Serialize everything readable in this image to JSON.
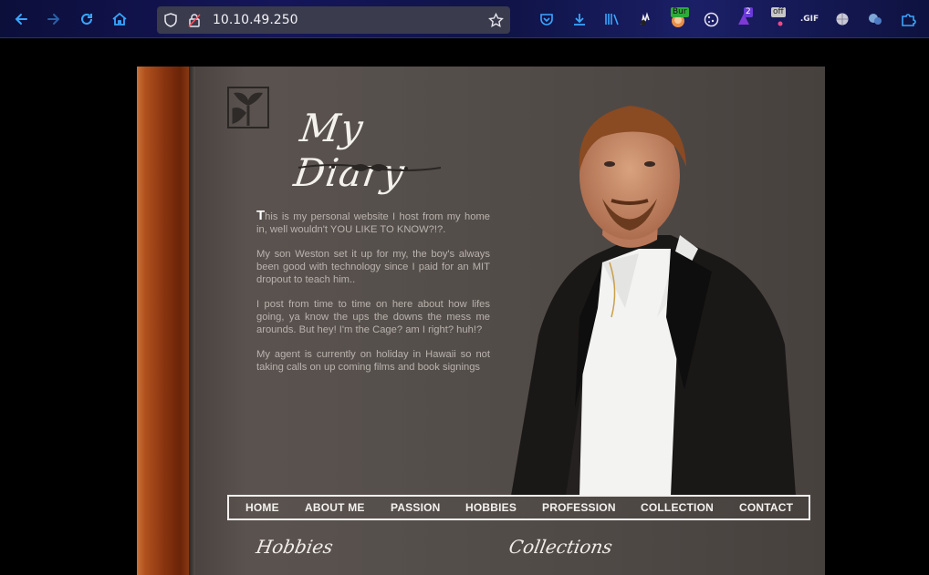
{
  "browser": {
    "url": "10.10.49.250",
    "extensions": {
      "burp_badge": "Bur",
      "counter_badge": "2",
      "off_badge": "off",
      "gif_label": ".GIF"
    }
  },
  "site": {
    "title": "My Diary",
    "intro": {
      "dropcap": "T",
      "p1_rest": "his is my personal website I host from my home in, well wouldn't YOU LIKE TO KNOW?!?.",
      "p2": "My son Weston set it up for my, the boy's always been good with technology since I paid for an MIT dropout to teach him..",
      "p3": "I post from time to time on here about how lifes going, ya know the ups the downs the mess me arounds. But hey! I'm the Cage? am I right? huh!?",
      "p4": "My agent is currently on holiday in Hawaii so not taking calls on up coming films and book signings"
    },
    "nav": [
      "HOME",
      "ABOUT ME",
      "PASSION",
      "HOBBIES",
      "PROFESSION",
      "COLLECTION",
      "CONTACT"
    ],
    "sections": {
      "hobbies": "Hobbies",
      "collections": "Collections"
    }
  },
  "colors": {
    "accent": "#3aa6ff",
    "sheet": "#524b48",
    "spine": "#8a3410"
  }
}
